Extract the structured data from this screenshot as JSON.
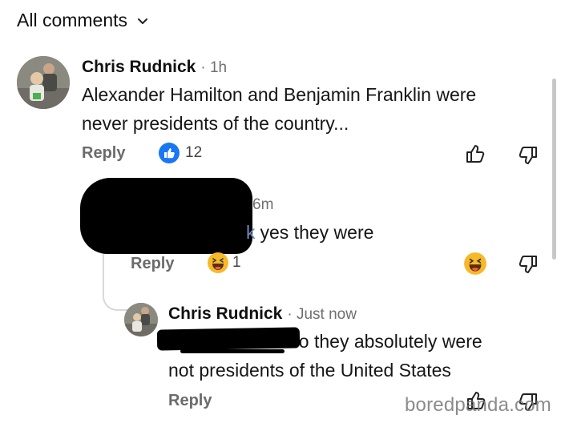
{
  "header": {
    "title": "All comments"
  },
  "comments": [
    {
      "author": "Chris Rudnick",
      "time": "· 1h",
      "lines": [
        "Alexander Hamilton and Benjamin Franklin were",
        "never presidents of the country..."
      ],
      "reply_label": "Reply",
      "reaction_count": "12"
    },
    {
      "time": "6m",
      "prefix": "k",
      "text": "yes they were",
      "reply_label": "Reply",
      "reaction_count": "1"
    },
    {
      "author": "Chris Rudnick",
      "time": "· Just now",
      "lines": [
        "no they absolutely were",
        "not presidents of the United States"
      ],
      "reply_label": "Reply"
    }
  ],
  "watermark": "boredpanda.com",
  "colors": {
    "like_blue": "#1877f2",
    "haha_yellow": "#f7b928",
    "muted": "#6b6b6b"
  },
  "icons": [
    "chevron-down-icon",
    "like-reaction-icon",
    "thumbs-up-icon",
    "thumbs-down-icon",
    "haha-reaction-icon"
  ]
}
